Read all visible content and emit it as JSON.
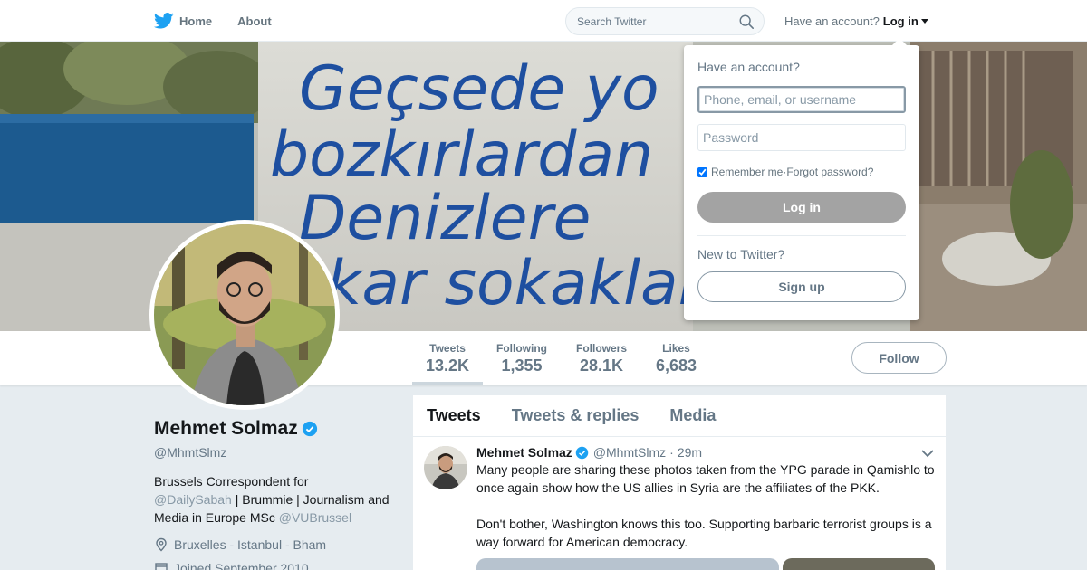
{
  "nav": {
    "home_label": "Home",
    "about_label": "About",
    "search_placeholder": "Search Twitter",
    "have_account_label": "Have an account?",
    "login_label": "Log in"
  },
  "banner": {
    "graffiti_lines": [
      "Geçsede yo",
      "bozkırlardan",
      "Denizlere",
      "kar sokaklar"
    ]
  },
  "stats": [
    {
      "label": "Tweets",
      "value": "13.2K"
    },
    {
      "label": "Following",
      "value": "1,355"
    },
    {
      "label": "Followers",
      "value": "28.1K"
    },
    {
      "label": "Likes",
      "value": "6,683"
    }
  ],
  "follow_label": "Follow",
  "profile": {
    "name": "Mehmet Solmaz",
    "handle": "@MhmtSlmz",
    "bio_1": "Brussels Correspondent for",
    "bio_link_1": "@DailySabah",
    "bio_2": " | Brummie | Journalism and Media in Europe MSc ",
    "bio_link_2": "@VUBrussel",
    "location": "Bruxelles - Istanbul - Bham",
    "joined": "Joined September 2010"
  },
  "timeline": {
    "tabs": [
      "Tweets",
      "Tweets & replies",
      "Media"
    ],
    "tweet": {
      "name": "Mehmet Solmaz",
      "handle": "@MhmtSlmz",
      "separator": "·",
      "time": "29m",
      "text": "Many people are sharing these photos taken from the YPG parade in Qamishlo to once again show how the US allies in Syria are the affiliates of the PKK.\n\nDon't bother, Washington knows this too. Supporting barbaric terrorist groups is a way forward for American democracy."
    }
  },
  "login_dropdown": {
    "title": "Have an account?",
    "username_placeholder": "Phone, email, or username",
    "password_placeholder": "Password",
    "remember_label": "Remember me",
    "separator": " · ",
    "forgot_label": "Forgot password?",
    "login_button": "Log in",
    "new_label": "New to Twitter?",
    "signup_button": "Sign up"
  },
  "colors": {
    "twitter_blue": "#1da1f2",
    "verified": "#1da1f2",
    "login_button_bg": "#a3a3a3"
  }
}
